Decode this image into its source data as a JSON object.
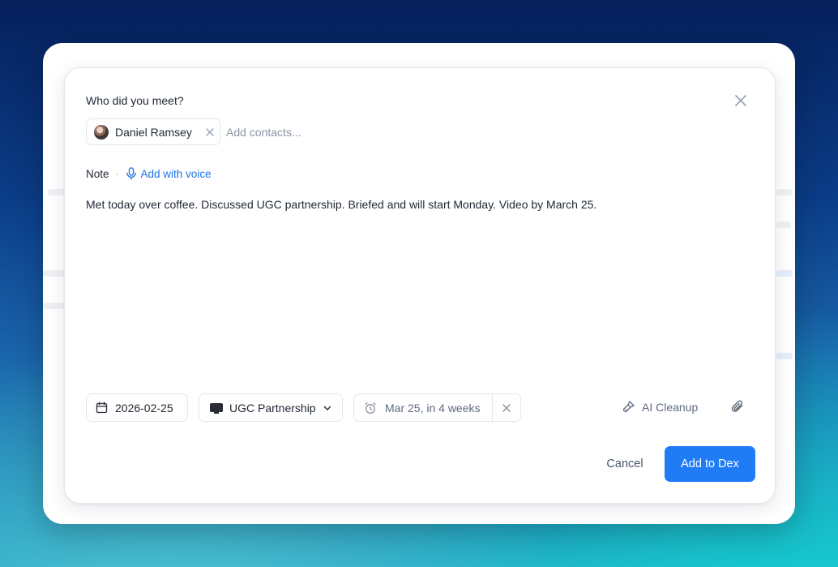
{
  "modal": {
    "question": "Who did you meet?",
    "contacts": [
      {
        "name": "Daniel Ramsey"
      }
    ],
    "add_contacts_placeholder": "Add contacts...",
    "note_label": "Note",
    "separator": "·",
    "add_voice_label": "Add with voice",
    "note_text": "Met today over coffee. Discussed UGC partnership. Briefed and will start Monday. Video by March 25.",
    "date": "2026-02-25",
    "project": "UGC Partnership",
    "reminder": "Mar 25, in 4 weeks",
    "ai_cleanup_label": "AI Cleanup",
    "cancel_label": "Cancel",
    "submit_label": "Add to Dex"
  },
  "icons": {
    "close": "close-icon",
    "chip_remove": "x-icon",
    "mic": "microphone-icon",
    "calendar": "calendar-icon",
    "project": "monitor-icon",
    "chevron": "chevron-down-icon",
    "alarm": "alarm-clock-icon",
    "reminder_clear": "x-icon",
    "ai_cleanup": "brush-icon",
    "attach": "paperclip-icon"
  },
  "colors": {
    "accent": "#1f7cf5",
    "link": "#1f74e8",
    "text": "#1f2733",
    "muted": "#5f6b7d",
    "border": "#e3e6ec"
  }
}
